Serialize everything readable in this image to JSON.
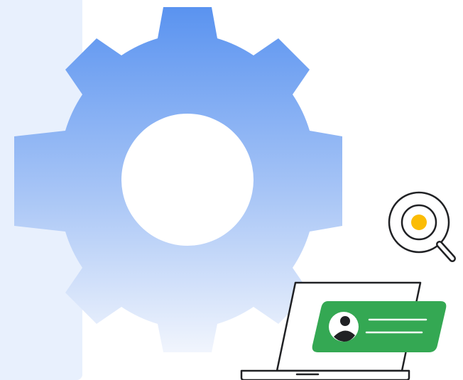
{
  "illustration": {
    "gear_icon": "gear-icon",
    "magnifier_icon": "magnifier-icon",
    "laptop_icon": "laptop-icon",
    "profile_card_icon": "profile-card-icon",
    "avatar_icon": "avatar-icon"
  },
  "colors": {
    "side_panel": "#e8f0fd",
    "gear_top": "#5a93f0",
    "gear_bottom": "#f1f5fd",
    "card_green": "#34a853",
    "magnifier_dot": "#fbbc04",
    "outline": "#202124"
  }
}
